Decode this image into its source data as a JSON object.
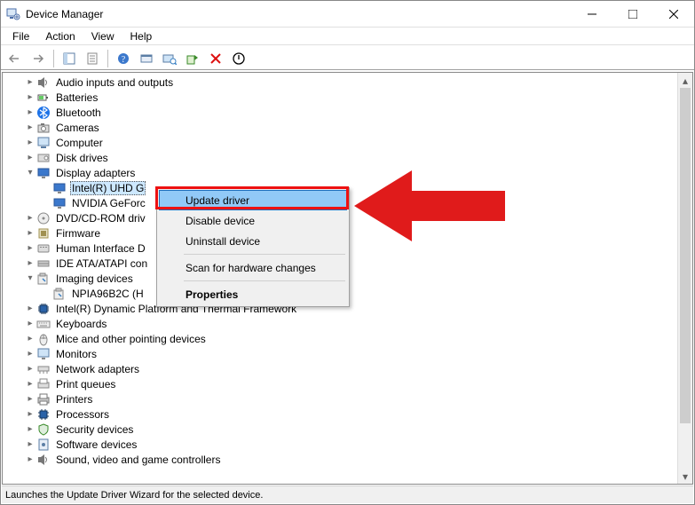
{
  "window": {
    "title": "Device Manager"
  },
  "menu": {
    "file": "File",
    "action": "Action",
    "view": "View",
    "help": "Help"
  },
  "status": {
    "text": "Launches the Update Driver Wizard for the selected device."
  },
  "tree": {
    "items": [
      {
        "label": "Audio inputs and outputs",
        "exp": "closed"
      },
      {
        "label": "Batteries",
        "exp": "closed"
      },
      {
        "label": "Bluetooth",
        "exp": "closed"
      },
      {
        "label": "Cameras",
        "exp": "closed"
      },
      {
        "label": "Computer",
        "exp": "closed"
      },
      {
        "label": "Disk drives",
        "exp": "closed"
      },
      {
        "label": "Display adapters",
        "exp": "open"
      },
      {
        "label": "DVD/CD-ROM driv",
        "exp": "closed"
      },
      {
        "label": "Firmware",
        "exp": "closed"
      },
      {
        "label": "Human Interface D",
        "exp": "closed"
      },
      {
        "label": "IDE ATA/ATAPI con",
        "exp": "closed"
      },
      {
        "label": "Imaging devices",
        "exp": "open"
      },
      {
        "label": "Intel(R) Dynamic Platform and Thermal Framework",
        "exp": "closed"
      },
      {
        "label": "Keyboards",
        "exp": "closed"
      },
      {
        "label": "Mice and other pointing devices",
        "exp": "closed"
      },
      {
        "label": "Monitors",
        "exp": "closed"
      },
      {
        "label": "Network adapters",
        "exp": "closed"
      },
      {
        "label": "Print queues",
        "exp": "closed"
      },
      {
        "label": "Printers",
        "exp": "closed"
      },
      {
        "label": "Processors",
        "exp": "closed"
      },
      {
        "label": "Security devices",
        "exp": "closed"
      },
      {
        "label": "Software devices",
        "exp": "closed"
      },
      {
        "label": "Sound, video and game controllers",
        "exp": "closed"
      }
    ],
    "display_children": [
      {
        "label": "Intel(R) UHD G"
      },
      {
        "label": "NVIDIA GeForc"
      }
    ],
    "imaging_children": [
      {
        "label": "NPIA96B2C (H"
      }
    ]
  },
  "ctx": {
    "update": "Update driver",
    "disable": "Disable device",
    "uninstall": "Uninstall device",
    "scan": "Scan for hardware changes",
    "props": "Properties"
  }
}
